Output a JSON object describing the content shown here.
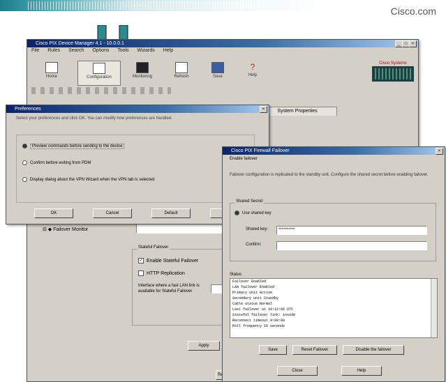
{
  "brand": "Cisco.com",
  "asdm": {
    "title": "Cisco PIX Device Manager 4.1 - 10.0.0.1",
    "menu": [
      "File",
      "Rules",
      "Search",
      "Options",
      "Tools",
      "Wizards",
      "Help"
    ],
    "toolbar": [
      "Home",
      "Configuration",
      "Monitoring",
      "Refresh",
      "Save",
      "Help"
    ],
    "logo_text": "Cisco Systems",
    "system_tab": "System Properties",
    "tree_item": "Failover Monitor",
    "stateful_legend": "Stateful Failover",
    "enable_stateful": "Enable Stateful Failover",
    "http_replication": "HTTP Replication",
    "interface_note": "Interface where a fast LAN link is available for Stateful Failover",
    "apply": "Apply",
    "reset": "Reset"
  },
  "prefs": {
    "title": "Preferences",
    "desc": "Select your preferences and click OK. You can modify how preferences are handled.",
    "opt1": "Preview commands before sending to the device",
    "opt2": "Confirm before exiting from PDM",
    "opt3": "Display dialog about the VPN Wizard when the VPN tab is selected",
    "ok": "OK",
    "cancel": "Cancel",
    "default": "Default",
    "help": "Help"
  },
  "wizard": {
    "title": "Cisco PIX Firewall Failover",
    "heading": "Enable failover",
    "desc": "Failover configuration is replicated to the standby unit. Configure the shared secret before enabling failover.",
    "grp_legend": "Shared Secret",
    "use_key": "Use shared key",
    "key_label": "Shared key:",
    "key_value": "**********",
    "confirm_label": "Confirm:",
    "status_legend": "Status",
    "status_lines": [
      "Failover        Enabled",
      "LAN failover     Enabled",
      "Primary unit     Active",
      "Secondary unit   Standby",
      "Cable status     Normal",
      "Last failover at 10:12:06 UTC",
      "Stateful failover link: inside",
      "Reconnect timeout 0:00:00",
      "Poll frequency 15 seconds"
    ],
    "btn_save": "Save",
    "btn_reset": "Reset Failover",
    "btn_disable": "Disable the failover",
    "btn_close": "Close",
    "btn_help": "Help"
  },
  "arrow_color": "#2c8b8b"
}
